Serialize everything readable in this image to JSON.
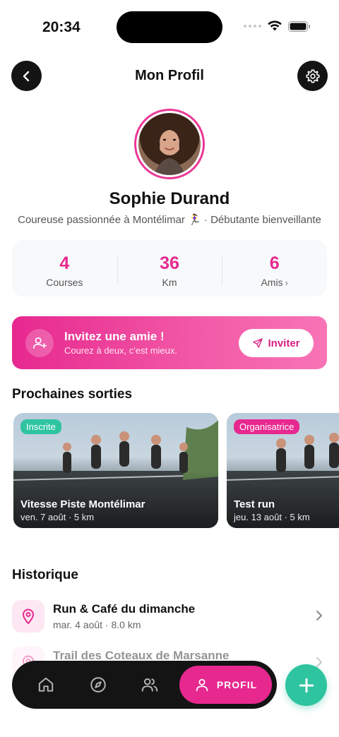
{
  "status_bar": {
    "time": "20:34"
  },
  "header": {
    "title": "Mon Profil"
  },
  "profile": {
    "name": "Sophie Durand",
    "bio": "Coureuse passionnée à Montélimar 🏃‍♀️ · Débutante bienveillante"
  },
  "stats": [
    {
      "value": "4",
      "label": "Courses"
    },
    {
      "value": "36",
      "label": "Km"
    },
    {
      "value": "6",
      "label": "Amis"
    }
  ],
  "invite": {
    "title": "Invitez une amie !",
    "subtitle": "Courez à deux, c'est mieux.",
    "button_label": "Inviter"
  },
  "upcoming": {
    "title": "Prochaines sorties",
    "events": [
      {
        "badge": "Inscrite",
        "title": "Vitesse Piste Montélimar",
        "meta": "ven. 7 août · 5 km"
      },
      {
        "badge": "Organisatrice",
        "title": "Test run",
        "meta": "jeu. 13 août · 5 km"
      }
    ]
  },
  "history": {
    "title": "Historique",
    "items": [
      {
        "title": "Run & Café du dimanche",
        "meta": "mar. 4 août · 8.0 km"
      },
      {
        "title": "Trail des Coteaux de Marsanne",
        "meta": ""
      }
    ]
  },
  "tab_bar": {
    "active_label": "PROFIL"
  },
  "colors": {
    "accent": "#e7288f",
    "teal": "#2ec4a0",
    "dark": "#141414"
  }
}
